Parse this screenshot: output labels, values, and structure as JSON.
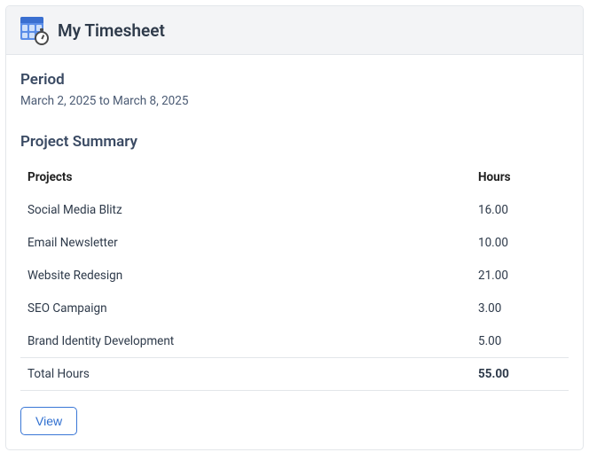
{
  "header": {
    "title": "My Timesheet"
  },
  "period": {
    "label": "Period",
    "value": "March 2, 2025 to March 8, 2025"
  },
  "summary": {
    "title": "Project Summary",
    "columns": {
      "project": "Projects",
      "hours": "Hours"
    },
    "rows": [
      {
        "project": "Social Media Blitz",
        "hours": "16.00"
      },
      {
        "project": "Email Newsletter",
        "hours": "10.00"
      },
      {
        "project": "Website Redesign",
        "hours": "21.00"
      },
      {
        "project": "SEO Campaign",
        "hours": "3.00"
      },
      {
        "project": "Brand Identity Development",
        "hours": "5.00"
      }
    ],
    "total": {
      "label": "Total Hours",
      "value": "55.00"
    }
  },
  "actions": {
    "view": "View"
  }
}
